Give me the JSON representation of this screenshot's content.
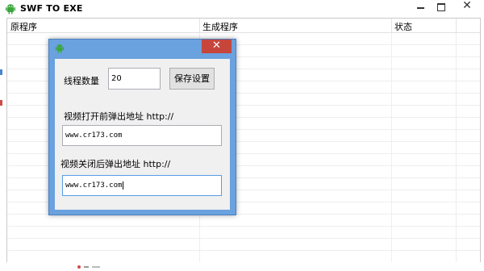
{
  "window": {
    "title": "SWF TO EXE"
  },
  "list": {
    "columns": [
      "原程序",
      "生成程序",
      "状态"
    ]
  },
  "dialog": {
    "threads_label": "线程数量",
    "threads_value": "20",
    "save_button": "保存设置",
    "open_popup_label": "视频打开前弹出地址 http://",
    "open_popup_value": "www.cr173.com",
    "close_popup_label": "视频关闭后弹出地址 http://",
    "close_popup_value": "www.cr173.com"
  },
  "colors": {
    "dialog_frame": "#6aa1df",
    "close_button": "#c7463c",
    "app_icon": "#3ca63c"
  },
  "icons": {
    "app": "android-icon",
    "dialog": "android-icon"
  }
}
